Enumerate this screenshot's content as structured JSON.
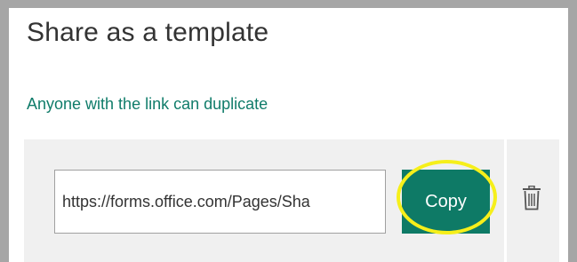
{
  "dialog": {
    "title": "Share as a template",
    "subtitle": "Anyone with the link can duplicate",
    "link_value": "https://forms.office.com/Pages/Sha",
    "copy_label": "Copy",
    "delete_icon": "trash-icon"
  },
  "colors": {
    "accent": "#107c6a",
    "copy_button": "#0e7a66",
    "highlight": "#f6ef1a",
    "frame": "#a6a6a6",
    "panel": "#f0f0f0"
  }
}
